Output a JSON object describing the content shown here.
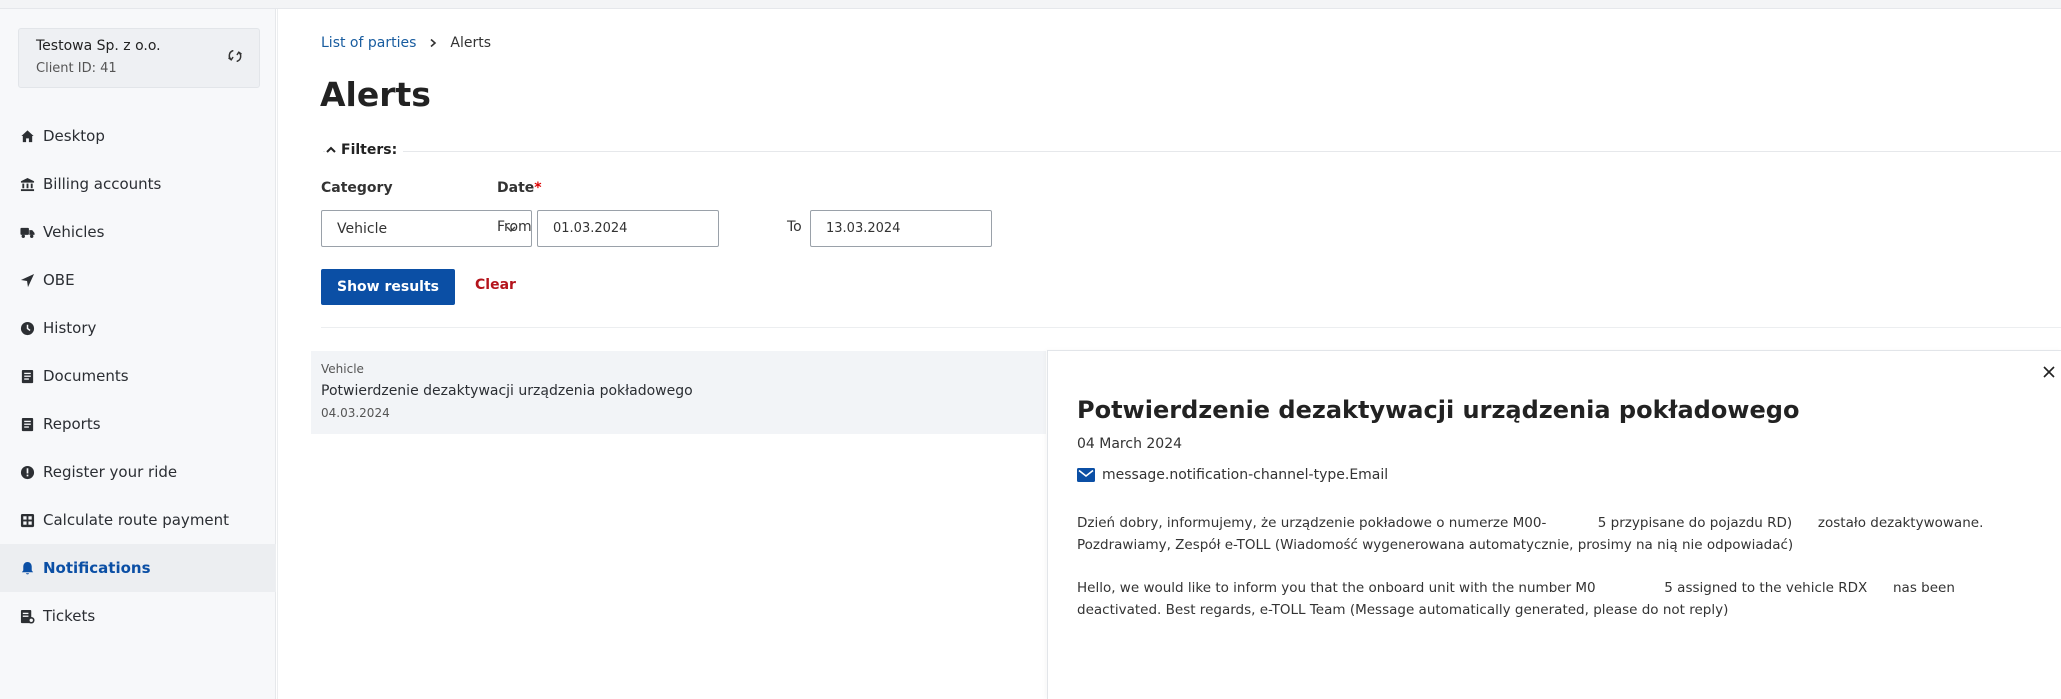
{
  "client": {
    "name": "Testowa Sp. z o.o.",
    "client_id": "Client ID: 41"
  },
  "sidebar": {
    "items": [
      {
        "label": "Desktop",
        "icon": "home-icon"
      },
      {
        "label": "Billing accounts",
        "icon": "bank-icon"
      },
      {
        "label": "Vehicles",
        "icon": "truck-icon"
      },
      {
        "label": "OBE",
        "icon": "location-arrow-icon"
      },
      {
        "label": "History",
        "icon": "clock-icon"
      },
      {
        "label": "Documents",
        "icon": "document-icon"
      },
      {
        "label": "Reports",
        "icon": "report-icon"
      },
      {
        "label": "Register your ride",
        "icon": "alert-circle-icon"
      },
      {
        "label": "Calculate route payment",
        "icon": "calculator-icon"
      },
      {
        "label": "Notifications",
        "icon": "bell-icon",
        "active": true
      },
      {
        "label": "Tickets",
        "icon": "ticket-icon"
      }
    ]
  },
  "breadcrumb": {
    "parent": "List of parties",
    "current": "Alerts"
  },
  "page": {
    "title": "Alerts"
  },
  "filters": {
    "toggle_label": "Filters:",
    "category_label": "Category",
    "category_value": "Vehicle",
    "date_label": "Date",
    "date_required_mark": "*",
    "from_label": "From",
    "from_value": "01.03.2024",
    "to_label": "To",
    "to_value": "13.03.2024",
    "show_results_label": "Show results",
    "clear_label": "Clear"
  },
  "results": [
    {
      "category": "Vehicle",
      "title": "Potwierdzenie dezaktywacji urządzenia pokładowego",
      "date": "04.03.2024"
    }
  ],
  "detail": {
    "title": "Potwierdzenie dezaktywacji urządzenia pokładowego",
    "date": "04 March 2024",
    "channel": "message.notification-channel-type.Email",
    "pl_line1": "Dzień dobry, informujemy, że urządzenie pokładowe o numerze M00-            5 przypisane do pojazdu RD)      zostało dezaktywowane.",
    "pl_line2": "Pozdrawiamy, Zespół e-TOLL (Wiadomość wygenerowana automatycznie, prosimy na nią nie odpowiadać)",
    "en_line1": "Hello, we would like to inform you that the onboard unit with the number M0                5 assigned to the vehicle RDX      nas been",
    "en_line2": "deactivated. Best regards, e-TOLL Team (Message automatically generated, please do not reply)"
  },
  "colors": {
    "primary": "#0b4fa5",
    "danger": "#b4141c",
    "link": "#185c9f"
  }
}
